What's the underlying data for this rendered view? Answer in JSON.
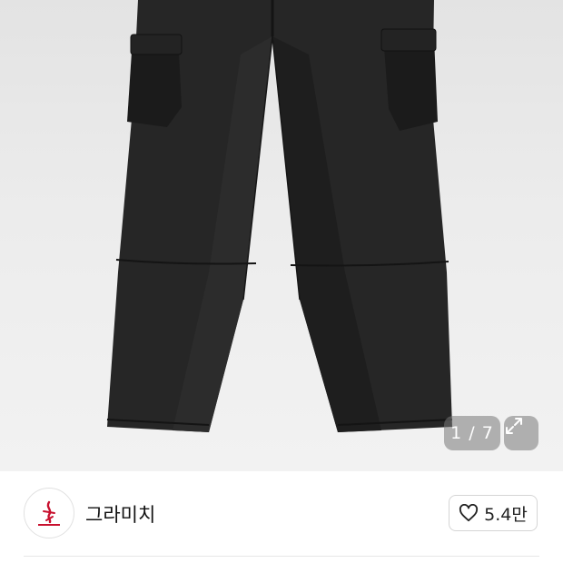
{
  "gallery": {
    "counter_text": "1 / 7",
    "expand_icon": "expand-icon",
    "product_image": "black-cargo-pants-photo"
  },
  "brand": {
    "name": "그라미치",
    "logo_icon": "gramicci-logo-icon",
    "logo_color": "#c8102e"
  },
  "like": {
    "icon": "heart-outline-icon",
    "count": "5.4만"
  }
}
